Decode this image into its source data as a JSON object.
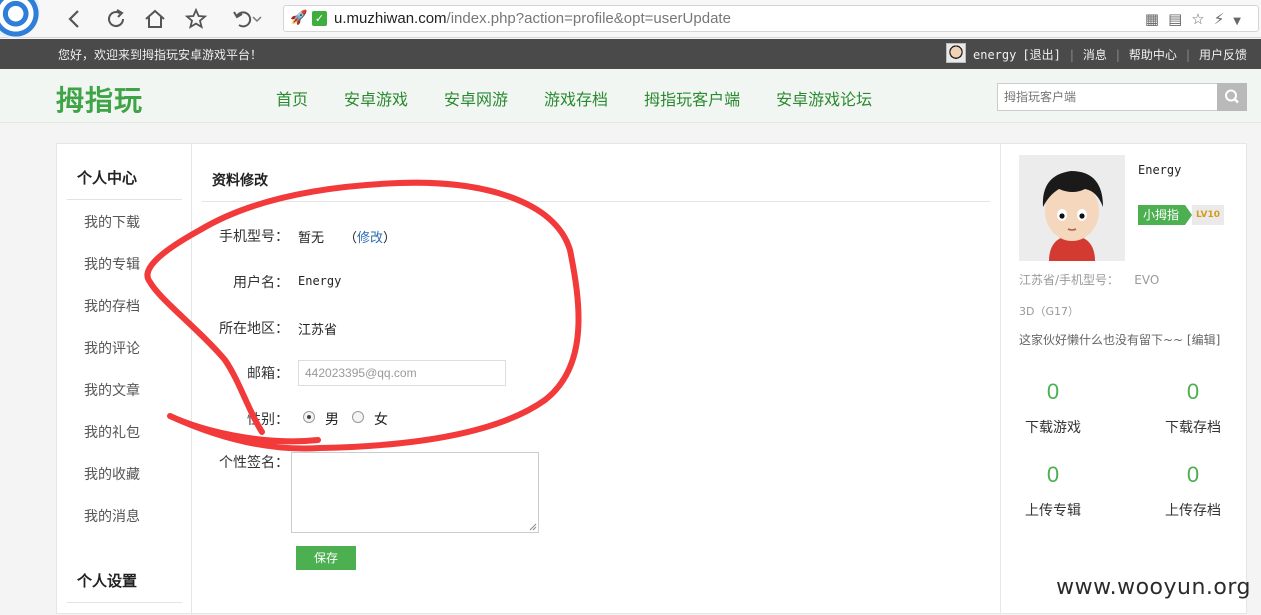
{
  "browser": {
    "url_host": "u.muzhiwan.com",
    "url_path": "/index.php?action=profile&opt=userUpdate"
  },
  "topbar": {
    "welcome": "您好，欢迎来到拇指玩安卓游戏平台！",
    "username": "energy",
    "logout": "[退出]",
    "messages": "消息",
    "help": "帮助中心",
    "feedback": "用户反馈"
  },
  "header": {
    "logo": "拇指玩",
    "nav": [
      "首页",
      "安卓游戏",
      "安卓网游",
      "游戏存档",
      "拇指玩客户端",
      "安卓游戏论坛"
    ],
    "search_placeholder": "拇指玩客户端"
  },
  "sidebar": {
    "section1_title": "个人中心",
    "items": [
      "我的下载",
      "我的专辑",
      "我的存档",
      "我的评论",
      "我的文章",
      "我的礼包",
      "我的收藏",
      "我的消息"
    ],
    "section2_title": "个人设置"
  },
  "form": {
    "title": "资料修改",
    "phone_label": "手机型号：",
    "phone_value": "暂无",
    "phone_edit": "修改",
    "phone_paren_open": "（",
    "phone_paren_close": "）",
    "username_label": "用户名：",
    "username_value": "Energy",
    "region_label": "所在地区：",
    "region_value": "江苏省",
    "email_label": "邮箱：",
    "email_value": "442023395@qq.com",
    "gender_label": "性别：",
    "gender_male": "男",
    "gender_female": "女",
    "signature_label": "个性签名：",
    "save_label": "保存"
  },
  "profile": {
    "name": "Energy",
    "badge": "小拇指",
    "level": "LV10",
    "location_line1": "江苏省/手机型号：    EVO",
    "location_line2": "3D（G17）",
    "bio": "这家伙好懒什么也没有留下~~ [编辑]",
    "stats": [
      {
        "value": "0",
        "label": "下载游戏"
      },
      {
        "value": "0",
        "label": "下载存档"
      },
      {
        "value": "0",
        "label": "上传专辑"
      },
      {
        "value": "0",
        "label": "上传存档"
      }
    ]
  },
  "colors": {
    "brand_green": "#3ea446",
    "annotation_red": "#f23a3a"
  },
  "watermark": "www.wooyun.org"
}
